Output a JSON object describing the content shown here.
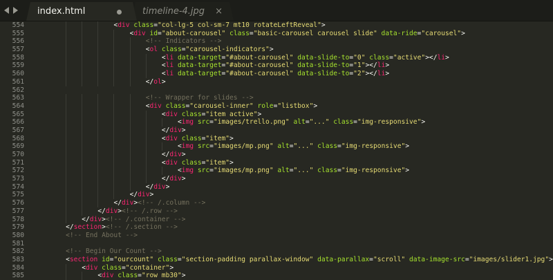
{
  "tabs": [
    {
      "label": "index.html",
      "active": true,
      "modified": true
    },
    {
      "label": "timeline-4.jpg",
      "active": false,
      "close_glyph": "×"
    }
  ],
  "colors": {
    "background": "#272822",
    "tag": "#f92672",
    "attribute": "#a6e22e",
    "string": "#e6db74",
    "comment": "#75715e",
    "text": "#f8f8f2",
    "line_number": "#8f908a"
  },
  "lines": [
    {
      "n": "554",
      "indent": 16,
      "tokens": [
        [
          "p",
          "<"
        ],
        [
          "t",
          "div"
        ],
        [
          "p",
          " "
        ],
        [
          "a",
          "class"
        ],
        [
          "p",
          "="
        ],
        [
          "s",
          "\"col-lg-5 col-sm-7 mt10 rotateLeftReveal\""
        ],
        [
          "p",
          ">"
        ]
      ]
    },
    {
      "n": "555",
      "indent": 20,
      "tokens": [
        [
          "p",
          "<"
        ],
        [
          "t",
          "div"
        ],
        [
          "p",
          " "
        ],
        [
          "a",
          "id"
        ],
        [
          "p",
          "="
        ],
        [
          "s",
          "\"about-carousel\""
        ],
        [
          "p",
          " "
        ],
        [
          "a",
          "class"
        ],
        [
          "p",
          "="
        ],
        [
          "s",
          "\"basic-carousel carousel slide\""
        ],
        [
          "p",
          " "
        ],
        [
          "a",
          "data-ride"
        ],
        [
          "p",
          "="
        ],
        [
          "s",
          "\"carousel\""
        ],
        [
          "p",
          ">"
        ]
      ]
    },
    {
      "n": "556",
      "indent": 24,
      "tokens": [
        [
          "c",
          "<!-- Indicators -->"
        ]
      ]
    },
    {
      "n": "557",
      "indent": 24,
      "tokens": [
        [
          "p",
          "<"
        ],
        [
          "t",
          "ol"
        ],
        [
          "p",
          " "
        ],
        [
          "a",
          "class"
        ],
        [
          "p",
          "="
        ],
        [
          "s",
          "\"carousel-indicators\""
        ],
        [
          "p",
          ">"
        ]
      ]
    },
    {
      "n": "558",
      "indent": 28,
      "tokens": [
        [
          "p",
          "<"
        ],
        [
          "t",
          "li"
        ],
        [
          "p",
          " "
        ],
        [
          "a",
          "data-target"
        ],
        [
          "p",
          "="
        ],
        [
          "s",
          "\"#about-carousel\""
        ],
        [
          "p",
          " "
        ],
        [
          "a",
          "data-slide-to"
        ],
        [
          "p",
          "="
        ],
        [
          "s",
          "\"0\""
        ],
        [
          "p",
          " "
        ],
        [
          "a",
          "class"
        ],
        [
          "p",
          "="
        ],
        [
          "s",
          "\"active\""
        ],
        [
          "p",
          "></"
        ],
        [
          "t",
          "li"
        ],
        [
          "p",
          ">"
        ]
      ]
    },
    {
      "n": "559",
      "indent": 28,
      "tokens": [
        [
          "p",
          "<"
        ],
        [
          "t",
          "li"
        ],
        [
          "p",
          " "
        ],
        [
          "a",
          "data-target"
        ],
        [
          "p",
          "="
        ],
        [
          "s",
          "\"#about-carousel\""
        ],
        [
          "p",
          " "
        ],
        [
          "a",
          "data-slide-to"
        ],
        [
          "p",
          "="
        ],
        [
          "s",
          "\"1\""
        ],
        [
          "p",
          "></"
        ],
        [
          "t",
          "li"
        ],
        [
          "p",
          ">"
        ]
      ]
    },
    {
      "n": "560",
      "indent": 28,
      "tokens": [
        [
          "p",
          "<"
        ],
        [
          "t",
          "li"
        ],
        [
          "p",
          " "
        ],
        [
          "a",
          "data-target"
        ],
        [
          "p",
          "="
        ],
        [
          "s",
          "\"#about-carousel\""
        ],
        [
          "p",
          " "
        ],
        [
          "a",
          "data-slide-to"
        ],
        [
          "p",
          "="
        ],
        [
          "s",
          "\"2\""
        ],
        [
          "p",
          "></"
        ],
        [
          "t",
          "li"
        ],
        [
          "p",
          ">"
        ]
      ]
    },
    {
      "n": "561",
      "indent": 24,
      "tokens": [
        [
          "p",
          "</"
        ],
        [
          "t",
          "ol"
        ],
        [
          "p",
          ">"
        ]
      ]
    },
    {
      "n": "562",
      "indent": 0,
      "tokens": []
    },
    {
      "n": "563",
      "indent": 24,
      "tokens": [
        [
          "c",
          "<!-- Wrapper for slides -->"
        ]
      ]
    },
    {
      "n": "564",
      "indent": 24,
      "tokens": [
        [
          "p",
          "<"
        ],
        [
          "t",
          "div"
        ],
        [
          "p",
          " "
        ],
        [
          "a",
          "class"
        ],
        [
          "p",
          "="
        ],
        [
          "s",
          "\"carousel-inner\""
        ],
        [
          "p",
          " "
        ],
        [
          "a",
          "role"
        ],
        [
          "p",
          "="
        ],
        [
          "s",
          "\"listbox\""
        ],
        [
          "p",
          ">"
        ]
      ]
    },
    {
      "n": "565",
      "indent": 28,
      "tokens": [
        [
          "p",
          "<"
        ],
        [
          "t",
          "div"
        ],
        [
          "p",
          " "
        ],
        [
          "a",
          "class"
        ],
        [
          "p",
          "="
        ],
        [
          "s",
          "\"item active\""
        ],
        [
          "p",
          ">"
        ]
      ]
    },
    {
      "n": "566",
      "indent": 32,
      "tokens": [
        [
          "p",
          "<"
        ],
        [
          "t",
          "img"
        ],
        [
          "p",
          " "
        ],
        [
          "a",
          "src"
        ],
        [
          "p",
          "="
        ],
        [
          "s",
          "\"images/trello.png\""
        ],
        [
          "p",
          " "
        ],
        [
          "a",
          "alt"
        ],
        [
          "p",
          "="
        ],
        [
          "s",
          "\"...\""
        ],
        [
          "p",
          " "
        ],
        [
          "a",
          "class"
        ],
        [
          "p",
          "="
        ],
        [
          "s",
          "\"img-responsive\""
        ],
        [
          "p",
          ">"
        ]
      ]
    },
    {
      "n": "567",
      "indent": 28,
      "tokens": [
        [
          "p",
          "</"
        ],
        [
          "t",
          "div"
        ],
        [
          "p",
          ">"
        ]
      ]
    },
    {
      "n": "568",
      "indent": 28,
      "tokens": [
        [
          "p",
          "<"
        ],
        [
          "t",
          "div"
        ],
        [
          "p",
          " "
        ],
        [
          "a",
          "class"
        ],
        [
          "p",
          "="
        ],
        [
          "s",
          "\"item\""
        ],
        [
          "p",
          ">"
        ]
      ]
    },
    {
      "n": "569",
      "indent": 32,
      "tokens": [
        [
          "p",
          "<"
        ],
        [
          "t",
          "img"
        ],
        [
          "p",
          " "
        ],
        [
          "a",
          "src"
        ],
        [
          "p",
          "="
        ],
        [
          "s",
          "\"images/mp.png\""
        ],
        [
          "p",
          " "
        ],
        [
          "a",
          "alt"
        ],
        [
          "p",
          "="
        ],
        [
          "s",
          "\"...\""
        ],
        [
          "p",
          " "
        ],
        [
          "a",
          "class"
        ],
        [
          "p",
          "="
        ],
        [
          "s",
          "\"img-responsive\""
        ],
        [
          "p",
          ">"
        ]
      ]
    },
    {
      "n": "570",
      "indent": 28,
      "tokens": [
        [
          "p",
          "</"
        ],
        [
          "t",
          "div"
        ],
        [
          "p",
          ">"
        ]
      ]
    },
    {
      "n": "571",
      "indent": 28,
      "tokens": [
        [
          "p",
          "<"
        ],
        [
          "t",
          "div"
        ],
        [
          "p",
          " "
        ],
        [
          "a",
          "class"
        ],
        [
          "p",
          "="
        ],
        [
          "s",
          "\"item\""
        ],
        [
          "p",
          ">"
        ]
      ]
    },
    {
      "n": "572",
      "indent": 32,
      "tokens": [
        [
          "p",
          "<"
        ],
        [
          "t",
          "img"
        ],
        [
          "p",
          " "
        ],
        [
          "a",
          "src"
        ],
        [
          "p",
          "="
        ],
        [
          "s",
          "\"images/mp.png\""
        ],
        [
          "p",
          " "
        ],
        [
          "a",
          "alt"
        ],
        [
          "p",
          "="
        ],
        [
          "s",
          "\"...\""
        ],
        [
          "p",
          " "
        ],
        [
          "a",
          "class"
        ],
        [
          "p",
          "="
        ],
        [
          "s",
          "\"img-responsive\""
        ],
        [
          "p",
          ">"
        ]
      ]
    },
    {
      "n": "573",
      "indent": 28,
      "tokens": [
        [
          "p",
          "</"
        ],
        [
          "t",
          "div"
        ],
        [
          "p",
          ">"
        ]
      ]
    },
    {
      "n": "574",
      "indent": 24,
      "tokens": [
        [
          "p",
          "</"
        ],
        [
          "t",
          "div"
        ],
        [
          "p",
          ">"
        ]
      ]
    },
    {
      "n": "575",
      "indent": 20,
      "tokens": [
        [
          "p",
          "</"
        ],
        [
          "t",
          "div"
        ],
        [
          "p",
          ">"
        ]
      ]
    },
    {
      "n": "576",
      "indent": 16,
      "tokens": [
        [
          "p",
          "</"
        ],
        [
          "t",
          "div"
        ],
        [
          "p",
          ">"
        ],
        [
          "c",
          "<!-- /.column -->"
        ]
      ]
    },
    {
      "n": "577",
      "indent": 12,
      "tokens": [
        [
          "p",
          "</"
        ],
        [
          "t",
          "div"
        ],
        [
          "p",
          ">"
        ],
        [
          "c",
          "<!-- /.row -->"
        ]
      ]
    },
    {
      "n": "578",
      "indent": 8,
      "tokens": [
        [
          "p",
          "</"
        ],
        [
          "t",
          "div"
        ],
        [
          "p",
          ">"
        ],
        [
          "c",
          "<!-- /.container -->"
        ]
      ]
    },
    {
      "n": "579",
      "indent": 4,
      "tokens": [
        [
          "p",
          "</"
        ],
        [
          "t",
          "section"
        ],
        [
          "p",
          ">"
        ],
        [
          "c",
          "<!-- /.section -->"
        ]
      ]
    },
    {
      "n": "580",
      "indent": 4,
      "tokens": [
        [
          "c",
          "<!-- End About -->"
        ]
      ]
    },
    {
      "n": "581",
      "indent": 0,
      "tokens": []
    },
    {
      "n": "582",
      "indent": 4,
      "tokens": [
        [
          "c",
          "<!-- Begin Our Count -->"
        ]
      ]
    },
    {
      "n": "583",
      "indent": 4,
      "tokens": [
        [
          "p",
          "<"
        ],
        [
          "t",
          "section"
        ],
        [
          "p",
          " "
        ],
        [
          "a",
          "id"
        ],
        [
          "p",
          "="
        ],
        [
          "s",
          "\"ourcount\""
        ],
        [
          "p",
          " "
        ],
        [
          "a",
          "class"
        ],
        [
          "p",
          "="
        ],
        [
          "s",
          "\"section-padding parallax-window\""
        ],
        [
          "p",
          " "
        ],
        [
          "a",
          "data-parallax"
        ],
        [
          "p",
          "="
        ],
        [
          "s",
          "\"scroll\""
        ],
        [
          "p",
          " "
        ],
        [
          "a",
          "data-image-src"
        ],
        [
          "p",
          "="
        ],
        [
          "s",
          "\"images/slider1.jpg\""
        ],
        [
          "p",
          ">"
        ]
      ]
    },
    {
      "n": "584",
      "indent": 8,
      "tokens": [
        [
          "p",
          "<"
        ],
        [
          "t",
          "div"
        ],
        [
          "p",
          " "
        ],
        [
          "a",
          "class"
        ],
        [
          "p",
          "="
        ],
        [
          "s",
          "\"container\""
        ],
        [
          "p",
          ">"
        ]
      ]
    },
    {
      "n": "585",
      "indent": 12,
      "tokens": [
        [
          "p",
          "<"
        ],
        [
          "t",
          "div"
        ],
        [
          "p",
          " "
        ],
        [
          "a",
          "class"
        ],
        [
          "p",
          "="
        ],
        [
          "s",
          "\"row mb30\""
        ],
        [
          "p",
          ">"
        ]
      ]
    }
  ]
}
